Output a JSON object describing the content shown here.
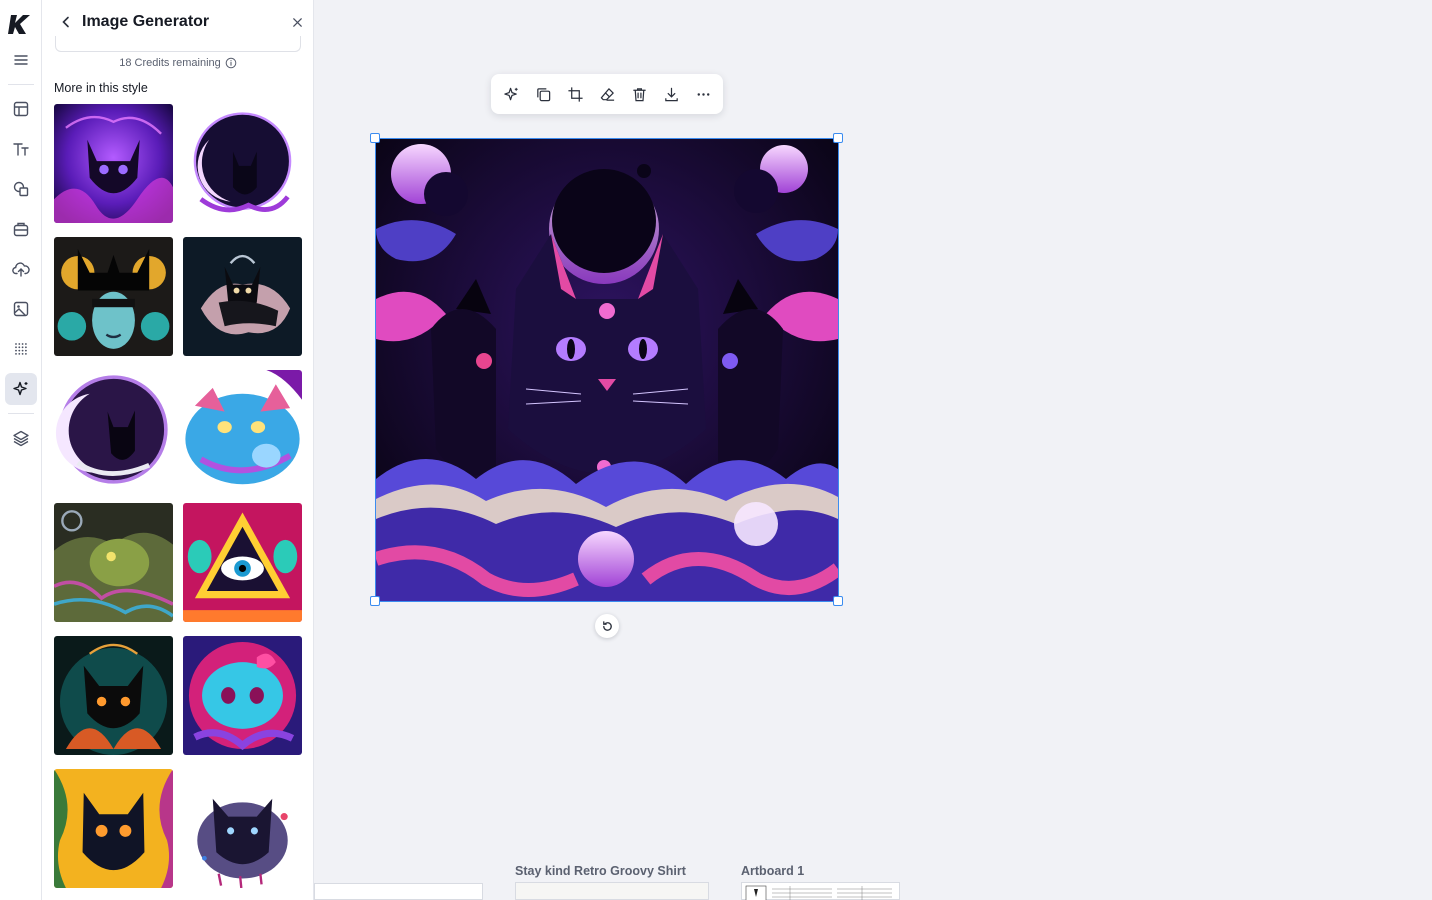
{
  "panel": {
    "title": "Image Generator",
    "credits_text": "18 Credits remaining",
    "section_title": "More in this style",
    "thumbnails": [
      {
        "name": "purple-cosmic-cat"
      },
      {
        "name": "moon-circle-cat"
      },
      {
        "name": "symmetric-cats-woman"
      },
      {
        "name": "spirit-wolf-dark"
      },
      {
        "name": "crescent-moon-cat"
      },
      {
        "name": "neon-fluffy-cat"
      },
      {
        "name": "psychedelic-creature"
      },
      {
        "name": "all-seeing-eye-aliens"
      },
      {
        "name": "mandala-black-cat"
      },
      {
        "name": "neon-kitty-skulls"
      },
      {
        "name": "yellow-swirl-black-cat"
      },
      {
        "name": "splatter-black-cat"
      }
    ]
  },
  "rail": {
    "icons": [
      "logo-icon",
      "menu-icon",
      "templates-icon",
      "text-icon",
      "shapes-icon",
      "elements-icon",
      "upload-icon",
      "photos-icon",
      "dots-pattern-icon",
      "ai-generator-icon",
      "layers-icon"
    ],
    "active": "ai-generator-icon"
  },
  "toolbar": {
    "icons": [
      "magic-edit-icon",
      "duplicate-icon",
      "crop-icon",
      "eraser-icon",
      "delete-icon",
      "download-icon",
      "more-icon"
    ]
  },
  "canvas": {
    "selected_image": "three-black-cats-cosmic",
    "artboards": [
      {
        "label": "Stay kind Retro Groovy Shirt"
      },
      {
        "label": "Artboard 1"
      }
    ]
  },
  "colors": {
    "accent": "#3b8cf0",
    "background": "#f1f2f6",
    "panel": "#ffffff"
  }
}
